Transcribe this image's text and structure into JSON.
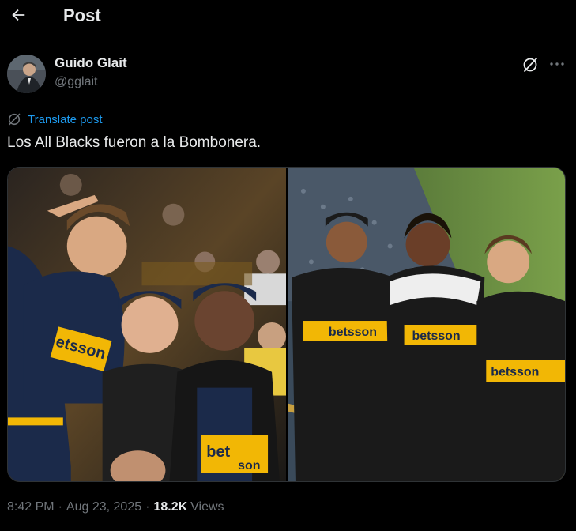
{
  "header": {
    "title": "Post",
    "back_icon": "arrow-left-icon"
  },
  "author": {
    "name": "Guido Glait",
    "handle": "@gglait",
    "avatar_icon": "avatar"
  },
  "actions": {
    "grok_icon": "grok-icon",
    "more_icon": "more-horizontal-icon"
  },
  "translate": {
    "label": "Translate post",
    "icon": "translate-icon"
  },
  "post": {
    "text": "Los All Blacks fueron a la Bombonera."
  },
  "media": {
    "photos": [
      {
        "name": "photo-left",
        "jersey_text": [
          "etsson",
          "bet",
          "son"
        ]
      },
      {
        "name": "photo-right",
        "jersey_text": [
          "betsson",
          "betsson",
          "betsson"
        ]
      }
    ]
  },
  "meta": {
    "time": "8:42 PM",
    "separator": "·",
    "date": "Aug 23, 2025",
    "views_count": "18.2K",
    "views_label": "Views"
  },
  "colors": {
    "background": "#000000",
    "text_primary": "#e7e9ea",
    "text_secondary": "#71767b",
    "link_blue": "#1d9bf0",
    "boca_navy": "#1b2a4a",
    "boca_gold": "#f2b705"
  }
}
